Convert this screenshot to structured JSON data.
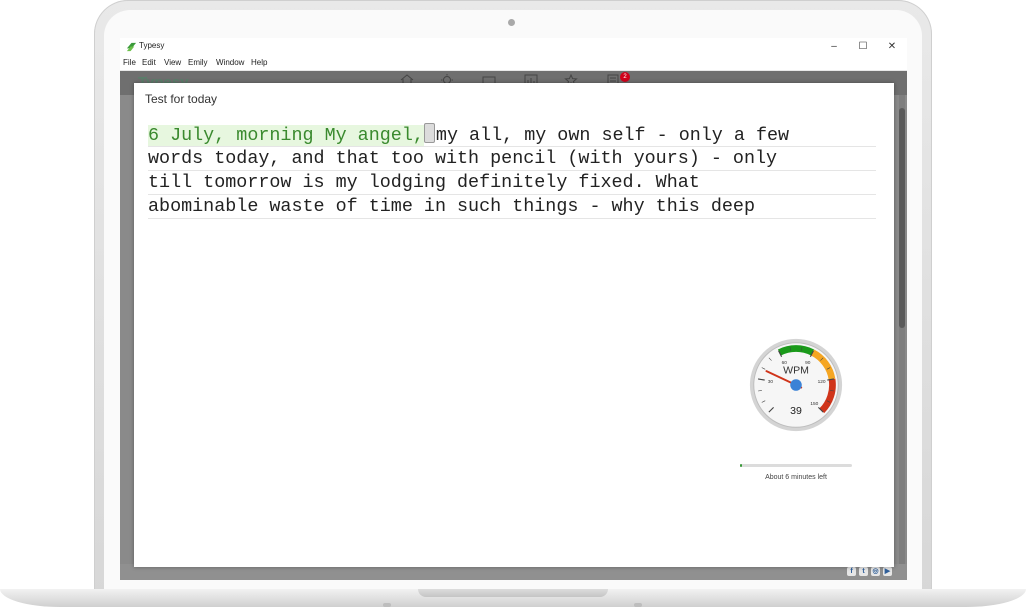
{
  "window": {
    "app_title": "Typesy",
    "minimize_glyph": "–",
    "maximize_glyph": "☐",
    "close_glyph": "✕"
  },
  "menu": [
    "File",
    "Edit",
    "View",
    "Emily",
    "Window",
    "Help"
  ],
  "toolbar": {
    "icons": [
      "home-icon",
      "lightbulb-icon",
      "keyboard-icon",
      "chart-icon",
      "star-icon",
      "clipboard-icon"
    ],
    "notification_count": "2"
  },
  "modal": {
    "title": "Test for today",
    "typed_text": "6 July, morning My angel,",
    "current_char": " ",
    "remaining_first_line": "my all, my own self - only a few",
    "lines": [
      "words today, and that too with pencil (with yours) - only",
      "till tomorrow is my lodging definitely fixed. What",
      "abominable waste of time in such things - why this deep"
    ]
  },
  "gauge": {
    "label": "WPM",
    "value": "39",
    "value_num": 39,
    "max": 150,
    "tick_labels": [
      "30",
      "60",
      "90",
      "120",
      "150"
    ]
  },
  "progress": {
    "fraction": 0.02,
    "time_left": "About 6 minutes left"
  },
  "colors": {
    "typed_green": "#3a8a2e",
    "gauge_green": "#1a9a1a",
    "gauge_orange": "#f5a623",
    "gauge_red": "#d0341a",
    "needle_blue": "#3b82d6"
  }
}
